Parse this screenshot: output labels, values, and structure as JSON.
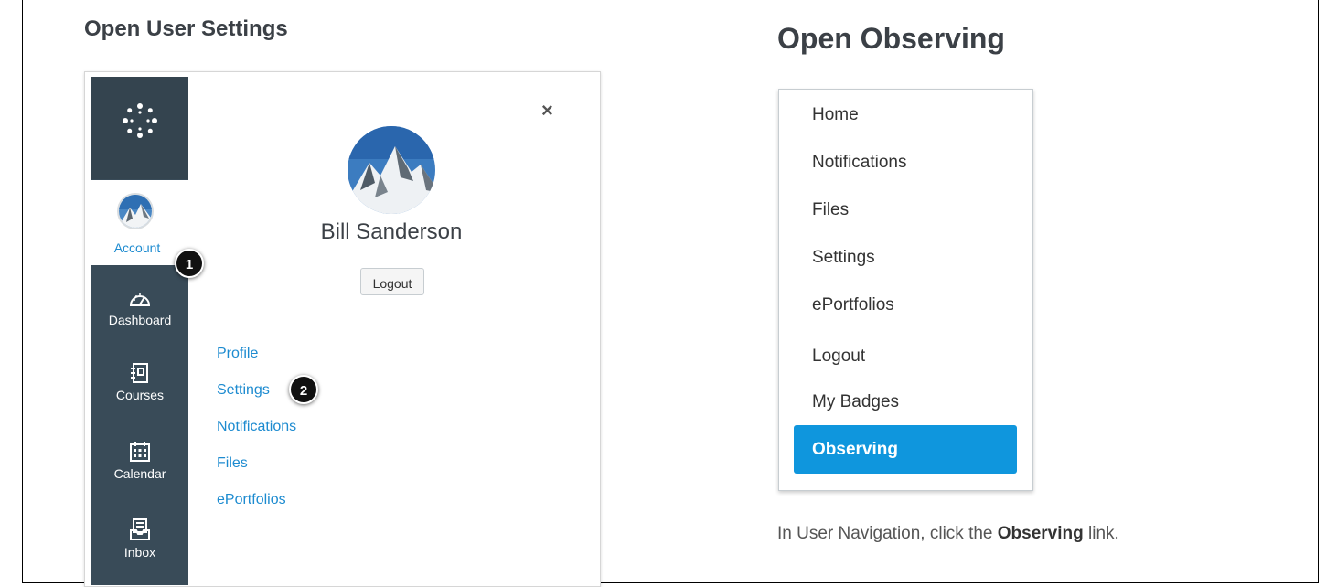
{
  "left": {
    "title": "Open User Settings",
    "nav": {
      "account_label": "Account",
      "dashboard_label": "Dashboard",
      "courses_label": "Courses",
      "calendar_label": "Calendar",
      "inbox_label": "Inbox"
    },
    "close_symbol": "×",
    "user_name": "Bill Sanderson",
    "logout_label": "Logout",
    "links": [
      "Profile",
      "Settings",
      "Notifications",
      "Files",
      "ePortfolios"
    ],
    "badges": [
      "1",
      "2"
    ]
  },
  "right": {
    "title": "Open Observing",
    "menu_items": [
      "Home",
      "Notifications",
      "Files",
      "Settings",
      "ePortfolios",
      "Logout",
      "My Badges"
    ],
    "active_item": "Observing",
    "caption_before": "In User Navigation, click the ",
    "caption_bold": "Observing",
    "caption_after": " link."
  },
  "colors": {
    "nav_bg": "#394b58",
    "link": "#1d8bd0",
    "active_bg": "#0f96dd"
  },
  "icons": [
    "canvas-logo-icon",
    "dashboard-icon",
    "courses-icon",
    "calendar-icon",
    "inbox-icon",
    "close-icon"
  ]
}
